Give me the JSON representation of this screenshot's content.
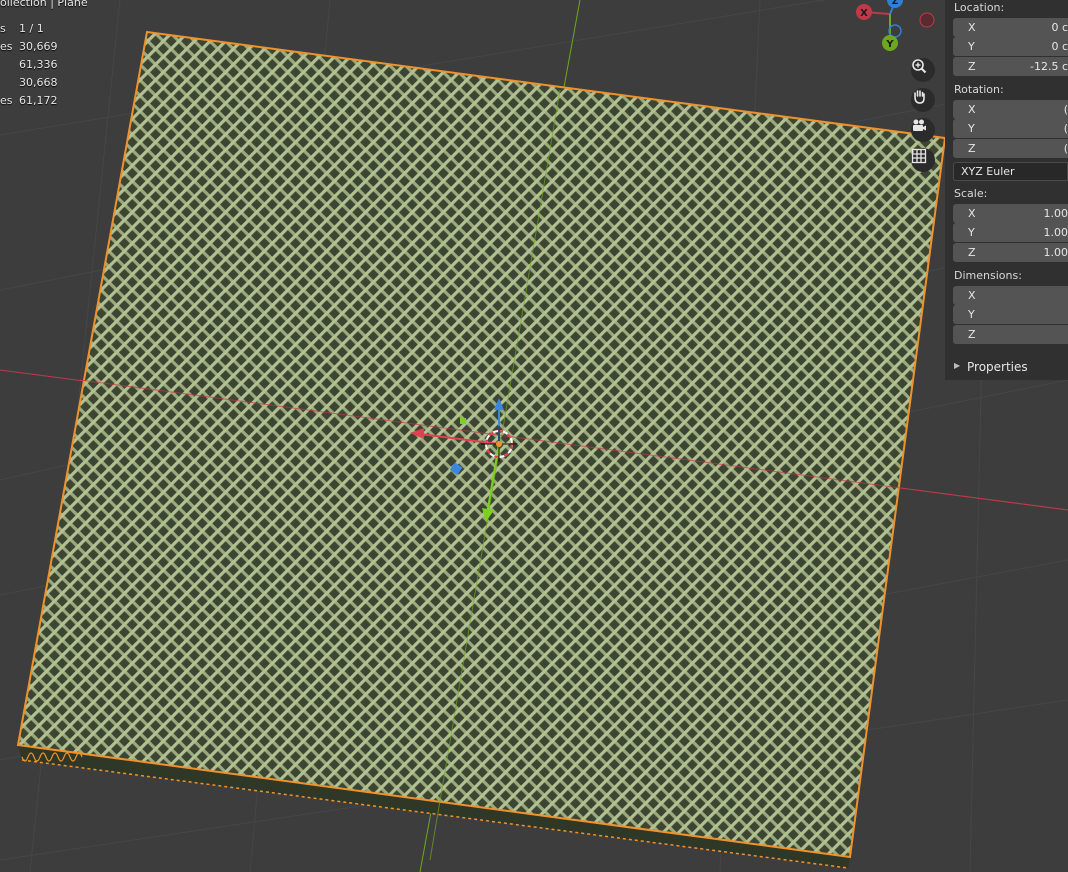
{
  "header": {
    "collection_path": "ollection | Plane"
  },
  "stats": [
    {
      "label": "s",
      "value": "1 / 1"
    },
    {
      "label": "es",
      "value": "30,669"
    },
    {
      "label": "",
      "value": "61,336"
    },
    {
      "label": "",
      "value": "30,668"
    },
    {
      "label": "es",
      "value": "61,172"
    }
  ],
  "nav_gizmo": {
    "x_label": "X",
    "y_label": "Y",
    "z_label": "Z"
  },
  "viewport_tools": [
    "zoom-icon",
    "pan-hand-icon",
    "camera-icon",
    "grid-icon"
  ],
  "npanel": {
    "location_label": "Location:",
    "location": [
      {
        "axis": "X",
        "value": "0 c"
      },
      {
        "axis": "Y",
        "value": "0 c"
      },
      {
        "axis": "Z",
        "value": "-12.5 c"
      }
    ],
    "rotation_label": "Rotation:",
    "rotation": [
      {
        "axis": "X",
        "value": "("
      },
      {
        "axis": "Y",
        "value": "("
      },
      {
        "axis": "Z",
        "value": "("
      }
    ],
    "rotation_mode": "XYZ Euler",
    "scale_label": "Scale:",
    "scale": [
      {
        "axis": "X",
        "value": "1.00"
      },
      {
        "axis": "Y",
        "value": "1.00"
      },
      {
        "axis": "Z",
        "value": "1.00"
      }
    ],
    "dimensions_label": "Dimensions:",
    "dimensions": [
      {
        "axis": "X",
        "value": ""
      },
      {
        "axis": "Y",
        "value": ""
      },
      {
        "axis": "Z",
        "value": ""
      }
    ],
    "properties_label": "Properties"
  },
  "colors": {
    "background": "#3d3d3d",
    "mesh": "#9aaa7c",
    "selection_outline": "#f0922c",
    "x_axis": "#c0394b",
    "y_axis": "#6ea81f",
    "z_axis": "#2f7fd6"
  }
}
